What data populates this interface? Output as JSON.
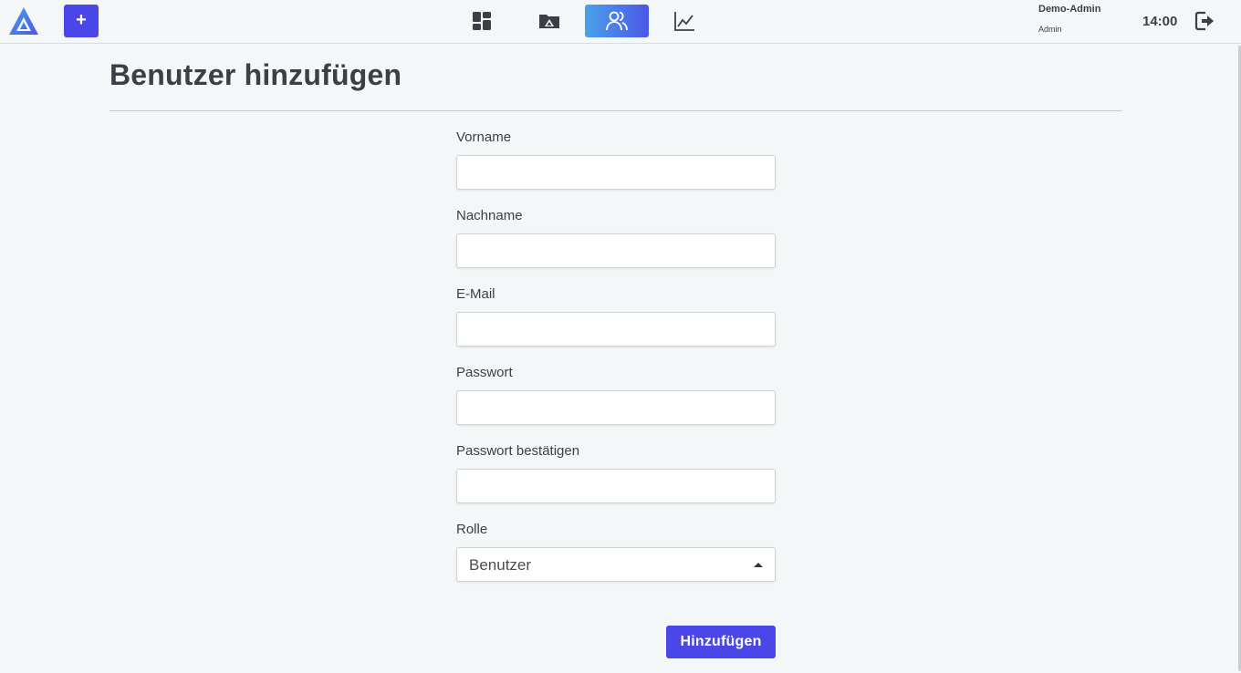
{
  "app": {
    "logo_icon": "triangle-logo-icon",
    "add_label": "+",
    "brand_color": "#4b46e8"
  },
  "nav": {
    "items": [
      {
        "icon": "dashboard-grid-icon",
        "active": false
      },
      {
        "icon": "folder-icon",
        "active": false
      },
      {
        "icon": "users-icon",
        "active": true
      },
      {
        "icon": "chart-line-icon",
        "active": false
      }
    ]
  },
  "user": {
    "name": "Demo-Admin",
    "role": "Admin",
    "time": "14:00",
    "logout_icon": "logout-icon"
  },
  "page": {
    "title": "Benutzer hinzufügen"
  },
  "form": {
    "first_name": {
      "label": "Vorname",
      "value": ""
    },
    "last_name": {
      "label": "Nachname",
      "value": ""
    },
    "email": {
      "label": "E-Mail",
      "value": ""
    },
    "password": {
      "label": "Passwort",
      "value": ""
    },
    "password_confirm": {
      "label": "Passwort bestätigen",
      "value": ""
    },
    "role": {
      "label": "Rolle",
      "selected": "Benutzer"
    },
    "submit_label": "Hinzufügen"
  }
}
